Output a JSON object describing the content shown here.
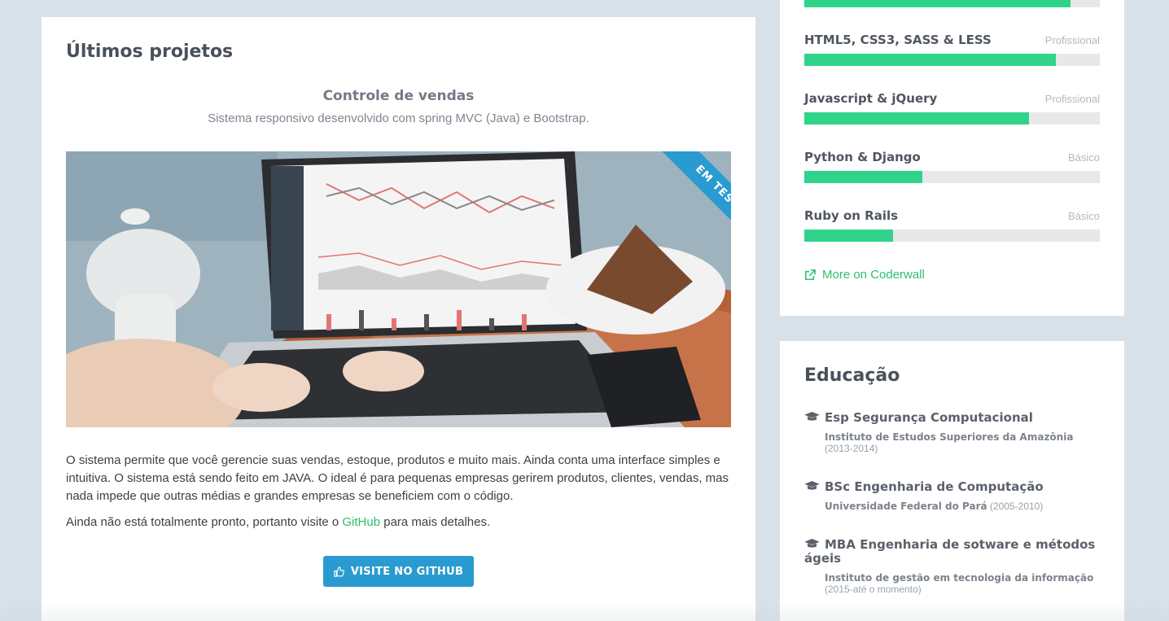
{
  "projects": {
    "section_title": "Últimos projetos",
    "title": "Controle de vendas",
    "subtitle": "Sistema responsivo desenvolvido com spring MVC (Java) e Bootstrap.",
    "ribbon": "EM TESTE",
    "description": "O sistema permite que você gerencie suas vendas, estoque, produtos e muito mais. Ainda conta uma interface simples e intuitiva. O sistema está sendo feito em JAVA. O ideal é para pequenas empresas gerirem produtos, clientes, vendas, mas nada impede que outras médias e grandes empresas se beneficiem com o código.",
    "note_before": "Ainda não está totalmente pronto, portanto visite o ",
    "note_link": "GitHub",
    "note_after": " para mais detalhes.",
    "button_label": "VISITE NO GITHUB"
  },
  "skills": {
    "top_bar_fraction": 0.9,
    "items": [
      {
        "name": "HTML5, CSS3, SASS & LESS",
        "level": "Profissional",
        "fraction": 0.85
      },
      {
        "name": "Javascript & jQuery",
        "level": "Profissional",
        "fraction": 0.76
      },
      {
        "name": "Python & Django",
        "level": "Básico",
        "fraction": 0.4
      },
      {
        "name": "Ruby on Rails",
        "level": "Básico",
        "fraction": 0.3
      }
    ],
    "coderwall_link": "More on Coderwall"
  },
  "education": {
    "title": "Educação",
    "items": [
      {
        "degree": "Esp Segurança Computacional",
        "institution": "Instituto de Estudos Superiores da Amazônia",
        "period": "(2013-2014)"
      },
      {
        "degree": "BSc Engenharia de Computação",
        "institution": "Universidade Federal do Pará",
        "period": "(2005-2010)"
      },
      {
        "degree": "MBA Engenharia de sotware e métodos ágeis",
        "institution": "Instituto de gestão em tecnologia da informação",
        "period": "(2015-até o momento)"
      }
    ]
  },
  "colors": {
    "accent_blue": "#2a9bd0",
    "accent_green": "#2fd48a",
    "link_green": "#2ec06d",
    "background": "#d6e2e8"
  }
}
